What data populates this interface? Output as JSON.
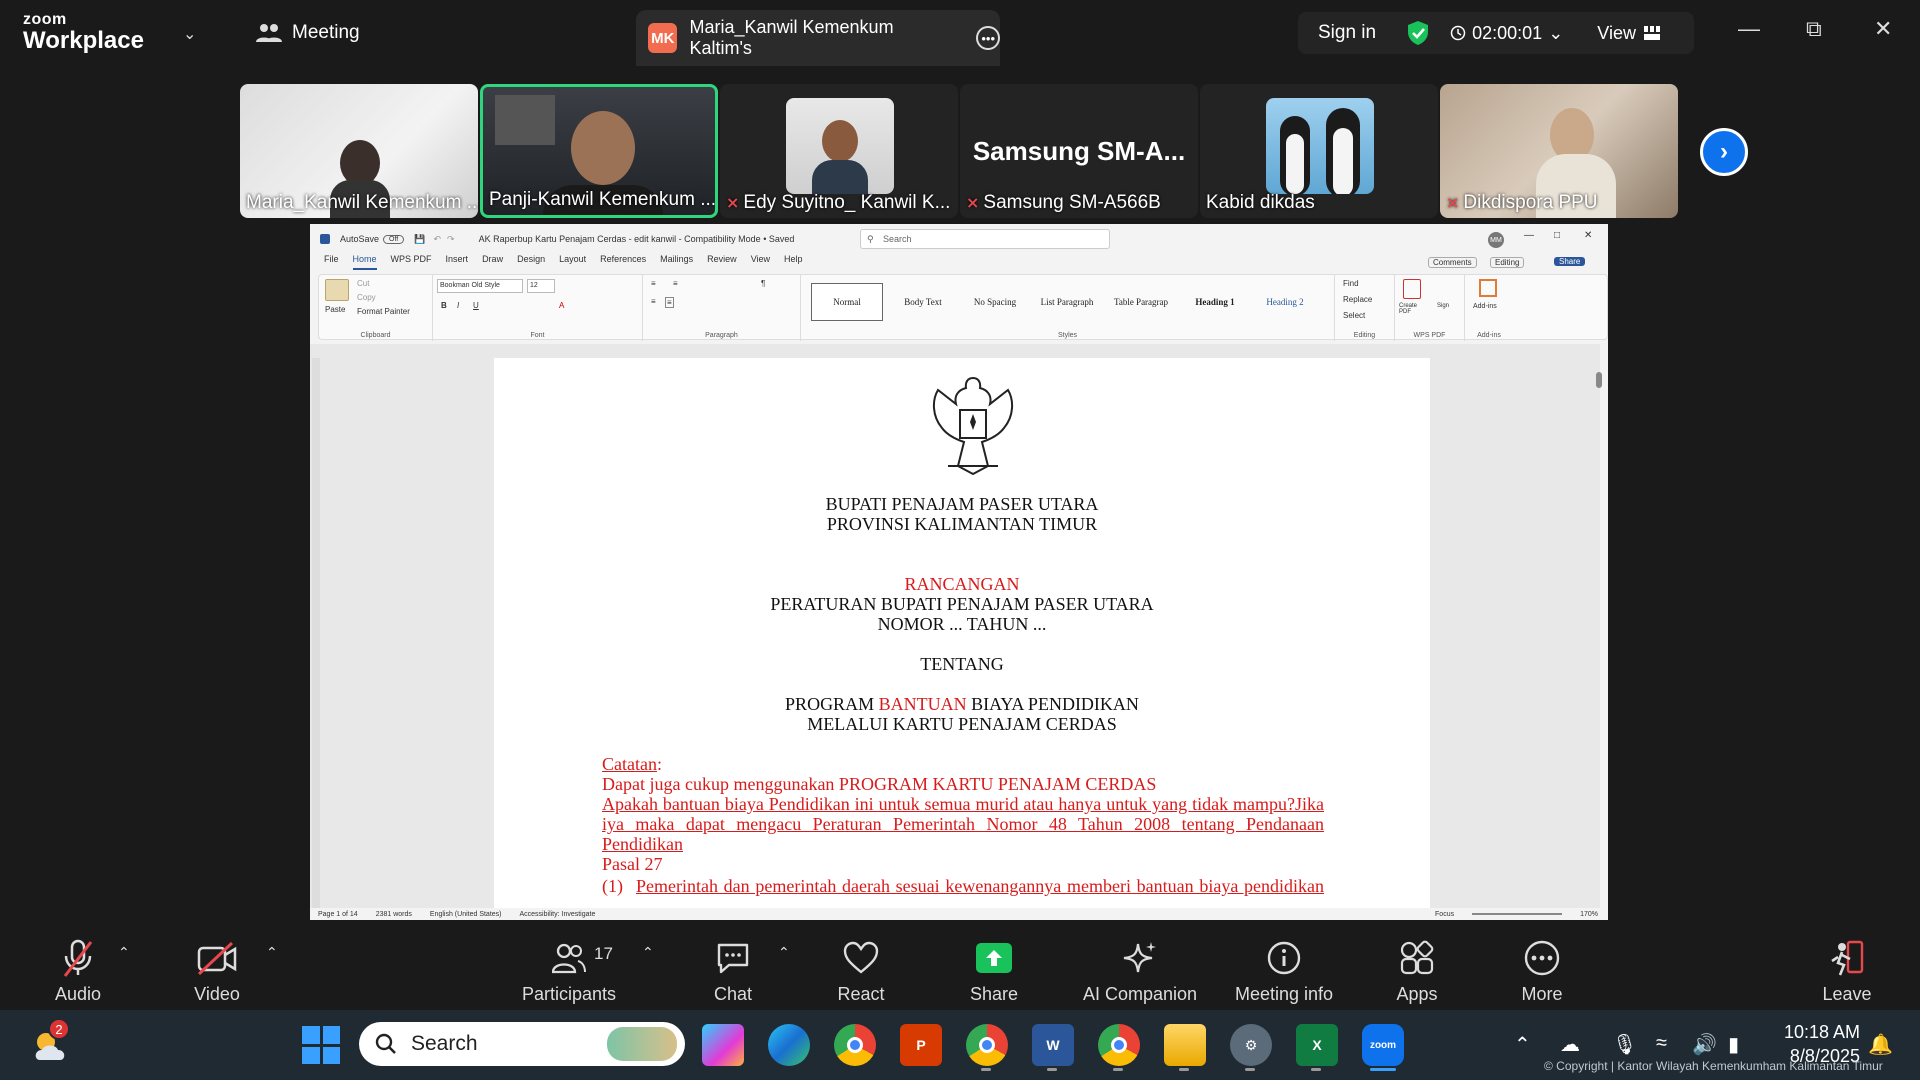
{
  "app": {
    "logo_line1": "zoom",
    "logo_line2": "Workplace",
    "meeting_label": "Meeting",
    "tab_initials": "MK",
    "tab_title": "Maria_Kanwil Kemenkum Kaltim's",
    "sign_in": "Sign in",
    "timer": "02:00:01",
    "view_label": "View"
  },
  "participants": [
    {
      "name": "Maria_Kanwil Kemenkum ...",
      "muted": false,
      "active": false
    },
    {
      "name": "Panji-Kanwil Kemenkum ...",
      "muted": false,
      "active": true
    },
    {
      "name": "Edy Suyitno_ Kanwil K...",
      "muted": true,
      "active": false
    },
    {
      "name": "Samsung SM-A566B",
      "muted": true,
      "active": false,
      "big_label": "Samsung  SM-A..."
    },
    {
      "name": "Kabid dikdas",
      "muted": false,
      "active": false
    },
    {
      "name": "Dikdispora PPU",
      "muted": true,
      "active": false
    }
  ],
  "word": {
    "autosave": "AutoSave",
    "autosave_state": "Off",
    "doc_title": "AK Raperbup Kartu Penajam Cerdas - edit kanwil  -  Compatibility Mode  •  Saved",
    "search_placeholder": "Search",
    "user_initials": "MM",
    "menu": [
      "File",
      "Home",
      "WPS PDF",
      "Insert",
      "Draw",
      "Design",
      "Layout",
      "References",
      "Mailings",
      "Review",
      "View",
      "Help"
    ],
    "comments": "Comments",
    "editing": "Editing",
    "share": "Share",
    "clipboard": {
      "paste": "Paste",
      "cut": "Cut",
      "copy": "Copy",
      "format_painter": "Format Painter",
      "caption": "Clipboard"
    },
    "font": {
      "name": "Bookman Old Style",
      "size": "12",
      "caption": "Font"
    },
    "paragraph_caption": "Paragraph",
    "styles": [
      "Normal",
      "Body Text",
      "No Spacing",
      "List Paragraph",
      "Table Paragrap",
      "Heading 1",
      "Heading 2"
    ],
    "styles_caption": "Styles",
    "editing_group": {
      "find": "Find",
      "replace": "Replace",
      "select": "Select",
      "caption": "Editing"
    },
    "wps": {
      "create_pdf": "Create PDF",
      "sign": "Sign",
      "caption": "WPS PDF"
    },
    "addins": {
      "label": "Add-ins",
      "caption": "Add-ins"
    },
    "status": {
      "page": "Page 1 of 14",
      "words": "2381 words",
      "language": "English (United States)",
      "accessibility": "Accessibility: Investigate",
      "focus": "Focus",
      "zoom": "170%"
    }
  },
  "document": {
    "line1": "BUPATI PENAJAM PASER UTARA",
    "line2": "PROVINSI KALIMANTAN TIMUR",
    "rancangan": "RANCANGAN",
    "peraturan": "PERATURAN BUPATI PENAJAM PASER UTARA",
    "nomor": "NOMOR ... TAHUN ...",
    "tentang": "TENTANG",
    "program_a": "PROGRAM ",
    "program_b": "BANTUAN",
    "program_c": " BIAYA PENDIDIKAN",
    "melalui": "MELALUI KARTU PENAJAM CERDAS",
    "catatan": "Catatan",
    "note1": "Dapat juga cukup menggunakan PROGRAM KARTU PENAJAM CERDAS",
    "note2": "Apakah bantuan biaya Pendidikan ini untuk semua murid atau hanya untuk yang tidak mampu?Jika iya maka dapat mengacu Peraturan Pemerintah Nomor 48 Tahun 2008 tentang Pendanaan Pendidikan",
    "pasal": "Pasal 27",
    "item1_num": "(1)",
    "item1": "Pemerintah dan pemerintah daerah sesuai kewenangannya memberi bantuan biaya pendidikan atau beasiswa kepada peserta didik yang"
  },
  "controls": {
    "audio": "Audio",
    "video": "Video",
    "participants": "Participants",
    "participant_count": "17",
    "chat": "Chat",
    "react": "React",
    "share": "Share",
    "ai": "AI Companion",
    "info": "Meeting info",
    "apps": "Apps",
    "more": "More",
    "leave": "Leave"
  },
  "taskbar": {
    "search": "Search",
    "weather_badge": "2",
    "time": "10:18 AM",
    "date": "8/8/2025",
    "copyright": "© Copyright | Kantor Wilayah Kemenkumham Kalimantan Timur"
  },
  "colors": {
    "zoom_blue": "#0e72ed",
    "active_border": "#2fd67b",
    "share_green": "#19c25a",
    "doc_red": "#d81b1b"
  }
}
